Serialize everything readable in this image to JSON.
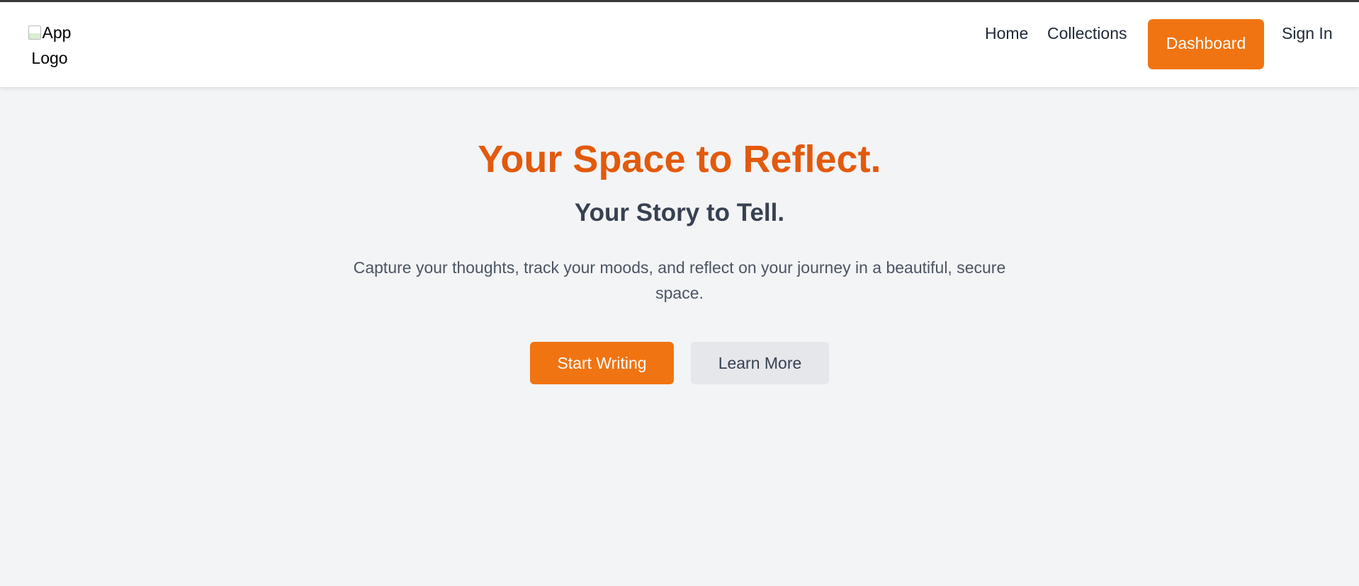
{
  "header": {
    "logo_alt": "App Logo",
    "nav": {
      "home": "Home",
      "collections": "Collections",
      "dashboard": "Dashboard",
      "sign_in": "Sign In"
    }
  },
  "hero": {
    "title": "Your Space to Reflect.",
    "subtitle": "Your Story to Tell.",
    "description": "Capture your thoughts, track your moods, and reflect on your journey in a beautiful, secure space.",
    "primary_button": "Start Writing",
    "secondary_button": "Learn More"
  },
  "colors": {
    "accent": "#f07412",
    "title": "#e25a0c",
    "background": "#f3f4f6",
    "secondary_button_bg": "#e5e7eb",
    "text_dark": "#374151"
  },
  "icons": {
    "logo": "broken-image-icon"
  }
}
